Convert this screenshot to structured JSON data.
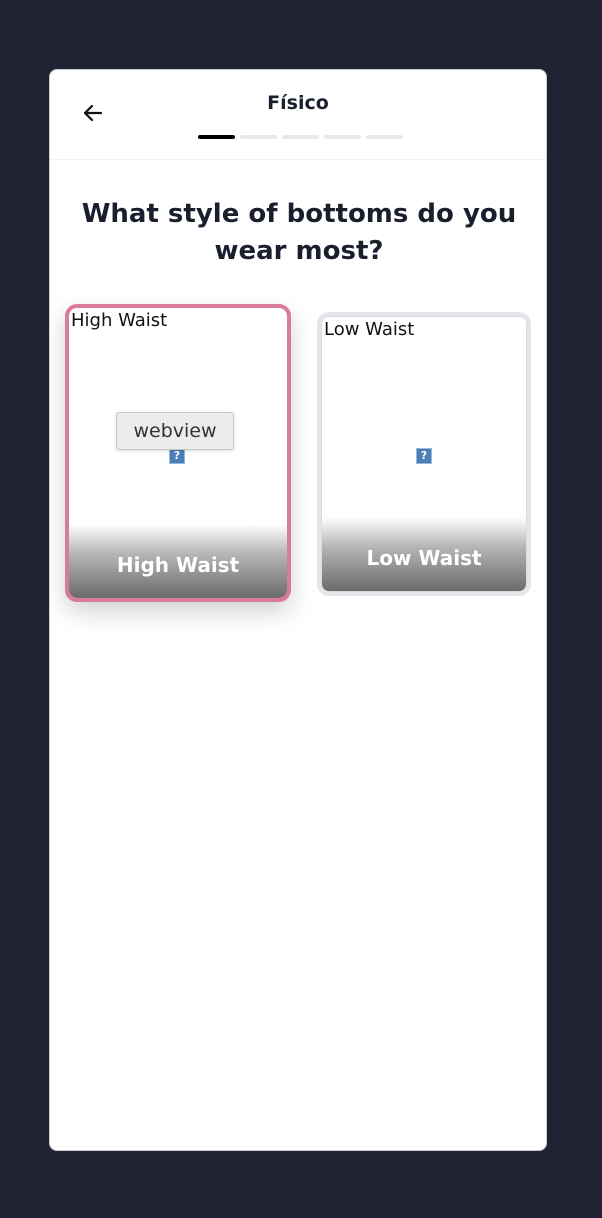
{
  "header": {
    "title": "Físico",
    "back_icon": "arrow-left-icon",
    "progress": {
      "total_steps": 5,
      "completed_steps": 1,
      "current_step_fill": 0.25
    }
  },
  "question": "What style of bottoms do you wear most?",
  "options": [
    {
      "alt_text": "High Waist",
      "label": "High Waist",
      "selected": true
    },
    {
      "alt_text": "Low Waist",
      "label": "Low Waist",
      "selected": false
    }
  ],
  "tooltip": "webview",
  "colors": {
    "background": "#1f2333",
    "selected_border": "#d97a9e",
    "text_dark": "#1a1f2e",
    "progress_active": "#000000",
    "progress_inactive": "#e8e9ec"
  }
}
